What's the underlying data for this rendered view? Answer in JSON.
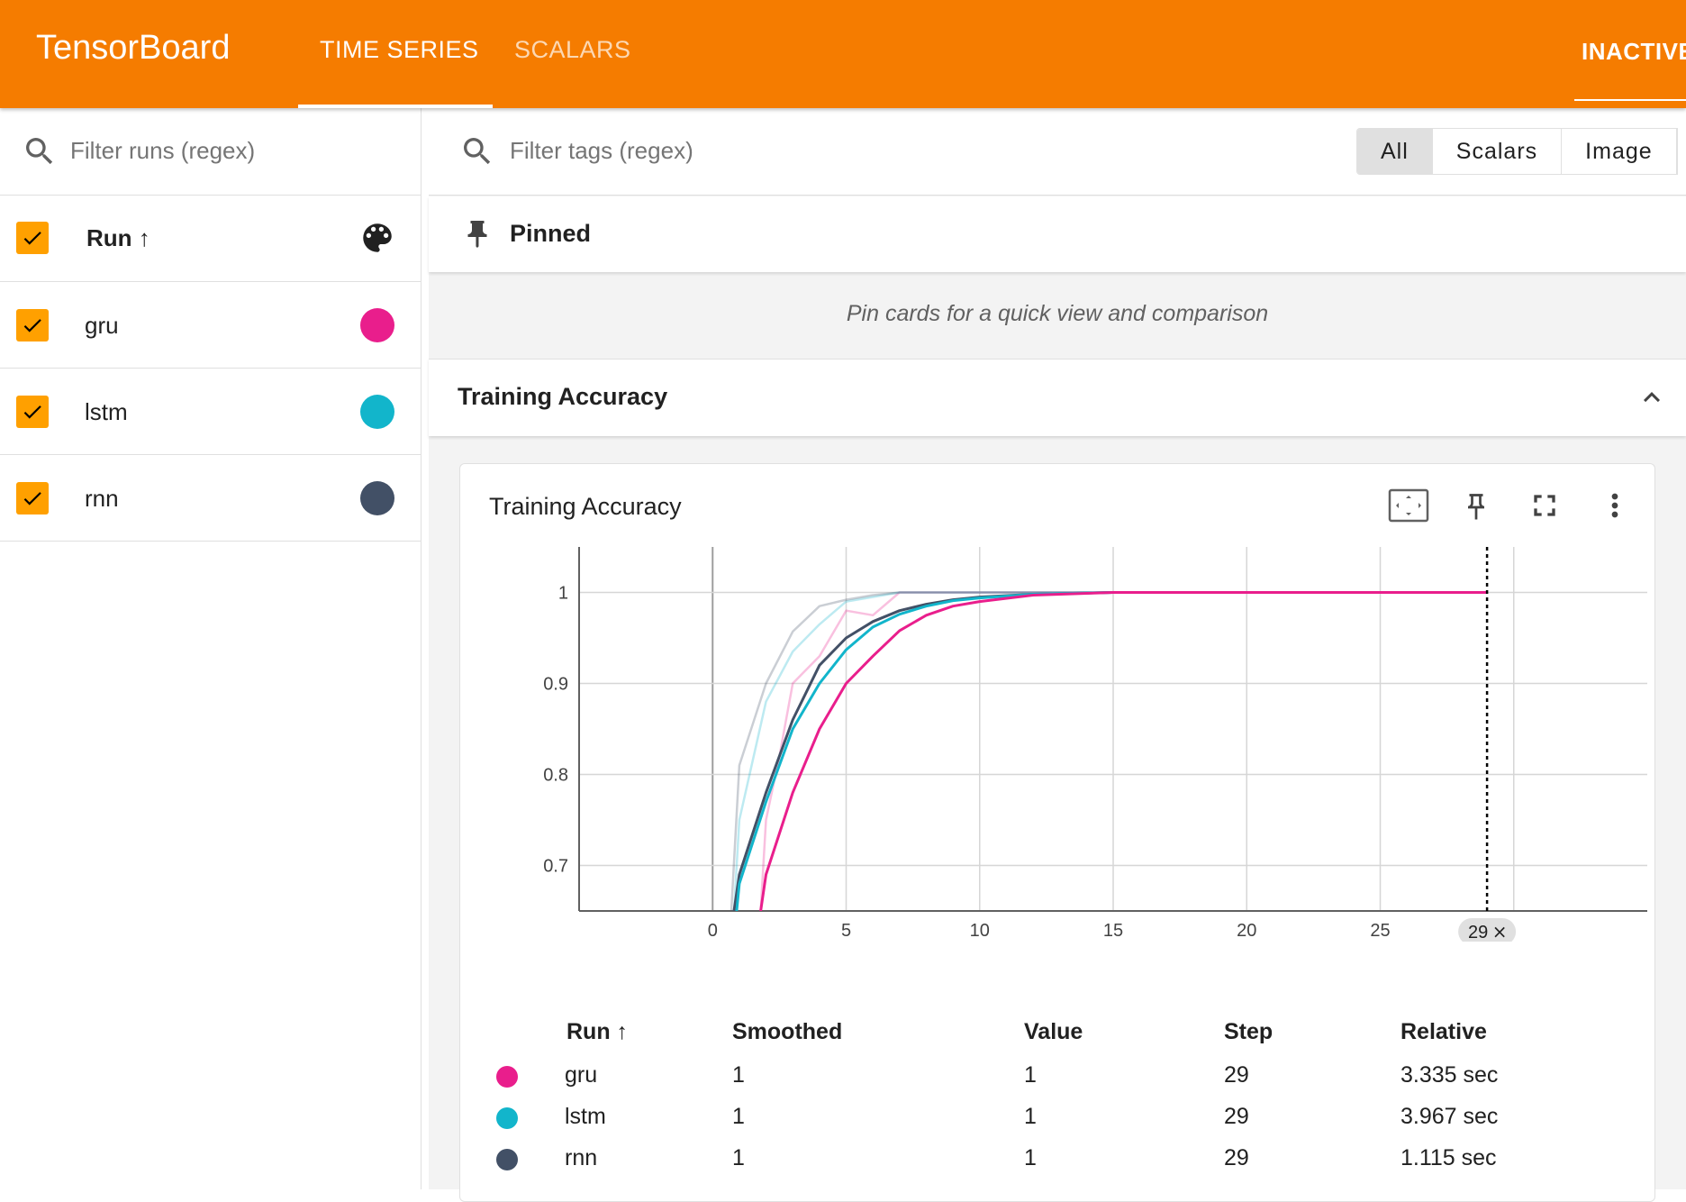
{
  "app": {
    "title": "TensorBoard"
  },
  "nav": {
    "tabs": [
      {
        "label": "TIME SERIES",
        "active": true
      },
      {
        "label": "SCALARS",
        "active": false
      }
    ],
    "inactive_label": "INACTIVE"
  },
  "sidebar": {
    "filter_placeholder": "Filter runs (regex)",
    "header_label": "Run ↑",
    "runs": [
      {
        "name": "gru",
        "color": "#e91e8c",
        "checked": true
      },
      {
        "name": "lstm",
        "color": "#12b5cb",
        "checked": true
      },
      {
        "name": "rnn",
        "color": "#425066",
        "checked": true
      }
    ]
  },
  "main": {
    "filter_placeholder": "Filter tags (regex)",
    "type_filters": [
      "All",
      "Scalars",
      "Image"
    ],
    "selected_type": "All",
    "pinned": {
      "title": "Pinned",
      "empty_message": "Pin cards for a quick view and comparison"
    },
    "group": {
      "title": "Training Accuracy"
    },
    "card": {
      "title": "Training Accuracy",
      "step_badge": "29",
      "legend": {
        "headers": [
          "Run ↑",
          "Smoothed",
          "Value",
          "Step",
          "Relative"
        ],
        "rows": [
          {
            "run": "gru",
            "smoothed": "1",
            "value": "1",
            "step": "29",
            "relative": "3.335 sec",
            "color": "#e91e8c"
          },
          {
            "run": "lstm",
            "smoothed": "1",
            "value": "1",
            "step": "29",
            "relative": "3.967 sec",
            "color": "#12b5cb"
          },
          {
            "run": "rnn",
            "smoothed": "1",
            "value": "1",
            "step": "29",
            "relative": "1.115 sec",
            "color": "#425066"
          }
        ]
      }
    }
  },
  "chart_data": {
    "type": "line",
    "title": "Training Accuracy",
    "xlabel": "",
    "ylabel": "",
    "xlim": [
      -5,
      35
    ],
    "ylim": [
      0.65,
      1.05
    ],
    "x_ticks": [
      0,
      5,
      10,
      15,
      20,
      25
    ],
    "y_ticks": [
      0.7,
      0.8,
      0.9,
      1
    ],
    "grid": true,
    "step_marker": 29,
    "series": [
      {
        "name": "gru",
        "color": "#e91e8c",
        "smoothed": [
          [
            1.8,
            0.65
          ],
          [
            2,
            0.69
          ],
          [
            3,
            0.78
          ],
          [
            4,
            0.85
          ],
          [
            5,
            0.9
          ],
          [
            6,
            0.93
          ],
          [
            7,
            0.958
          ],
          [
            8,
            0.975
          ],
          [
            9,
            0.985
          ],
          [
            10,
            0.99
          ],
          [
            12,
            0.997
          ],
          [
            15,
            1
          ],
          [
            29,
            1
          ]
        ],
        "raw": [
          [
            1.8,
            0.65
          ],
          [
            2,
            0.75
          ],
          [
            2.5,
            0.82
          ],
          [
            3,
            0.9
          ],
          [
            4,
            0.93
          ],
          [
            5,
            0.98
          ],
          [
            6,
            0.975
          ],
          [
            7,
            1
          ],
          [
            29,
            1
          ]
        ]
      },
      {
        "name": "lstm",
        "color": "#12b5cb",
        "smoothed": [
          [
            0.9,
            0.65
          ],
          [
            1,
            0.68
          ],
          [
            2,
            0.77
          ],
          [
            3,
            0.85
          ],
          [
            4,
            0.9
          ],
          [
            5,
            0.937
          ],
          [
            6,
            0.962
          ],
          [
            7,
            0.976
          ],
          [
            8,
            0.985
          ],
          [
            9,
            0.991
          ],
          [
            10,
            0.994
          ],
          [
            12,
            0.998
          ],
          [
            15,
            1
          ],
          [
            29,
            1
          ]
        ],
        "raw": [
          [
            0.8,
            0.65
          ],
          [
            1,
            0.75
          ],
          [
            2,
            0.88
          ],
          [
            3,
            0.935
          ],
          [
            4,
            0.965
          ],
          [
            5,
            0.99
          ],
          [
            7,
            1
          ],
          [
            29,
            1
          ]
        ]
      },
      {
        "name": "rnn",
        "color": "#425066",
        "smoothed": [
          [
            0.8,
            0.65
          ],
          [
            1,
            0.69
          ],
          [
            2,
            0.78
          ],
          [
            3,
            0.86
          ],
          [
            4,
            0.92
          ],
          [
            5,
            0.95
          ],
          [
            6,
            0.968
          ],
          [
            7,
            0.98
          ],
          [
            8,
            0.987
          ],
          [
            9,
            0.992
          ],
          [
            10,
            0.995
          ],
          [
            12,
            0.998
          ],
          [
            15,
            1
          ],
          [
            29,
            1
          ]
        ],
        "raw": [
          [
            0.7,
            0.65
          ],
          [
            1,
            0.81
          ],
          [
            2,
            0.9
          ],
          [
            3,
            0.957
          ],
          [
            4,
            0.985
          ],
          [
            5,
            0.992
          ],
          [
            6,
            0.997
          ],
          [
            7,
            1
          ],
          [
            29,
            1
          ]
        ]
      }
    ]
  }
}
